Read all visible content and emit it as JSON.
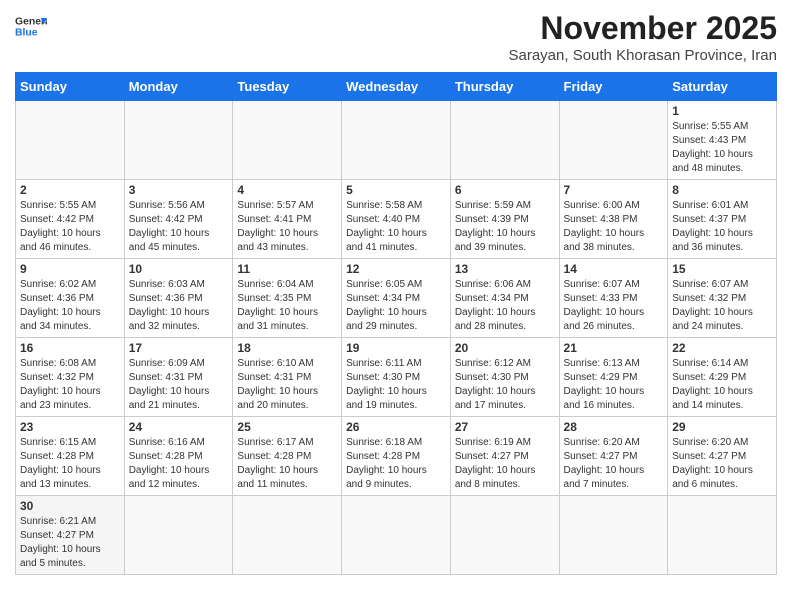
{
  "header": {
    "logo_general": "General",
    "logo_blue": "Blue",
    "month_year": "November 2025",
    "location": "Sarayan, South Khorasan Province, Iran"
  },
  "days_of_week": [
    "Sunday",
    "Monday",
    "Tuesday",
    "Wednesday",
    "Thursday",
    "Friday",
    "Saturday"
  ],
  "weeks": [
    [
      {
        "day": "",
        "info": ""
      },
      {
        "day": "",
        "info": ""
      },
      {
        "day": "",
        "info": ""
      },
      {
        "day": "",
        "info": ""
      },
      {
        "day": "",
        "info": ""
      },
      {
        "day": "",
        "info": ""
      },
      {
        "day": "1",
        "info": "Sunrise: 5:55 AM\nSunset: 4:43 PM\nDaylight: 10 hours\nand 48 minutes."
      }
    ],
    [
      {
        "day": "2",
        "info": "Sunrise: 5:55 AM\nSunset: 4:42 PM\nDaylight: 10 hours\nand 46 minutes."
      },
      {
        "day": "3",
        "info": "Sunrise: 5:56 AM\nSunset: 4:42 PM\nDaylight: 10 hours\nand 45 minutes."
      },
      {
        "day": "4",
        "info": "Sunrise: 5:57 AM\nSunset: 4:41 PM\nDaylight: 10 hours\nand 43 minutes."
      },
      {
        "day": "5",
        "info": "Sunrise: 5:58 AM\nSunset: 4:40 PM\nDaylight: 10 hours\nand 41 minutes."
      },
      {
        "day": "6",
        "info": "Sunrise: 5:59 AM\nSunset: 4:39 PM\nDaylight: 10 hours\nand 39 minutes."
      },
      {
        "day": "7",
        "info": "Sunrise: 6:00 AM\nSunset: 4:38 PM\nDaylight: 10 hours\nand 38 minutes."
      },
      {
        "day": "8",
        "info": "Sunrise: 6:01 AM\nSunset: 4:37 PM\nDaylight: 10 hours\nand 36 minutes."
      }
    ],
    [
      {
        "day": "9",
        "info": "Sunrise: 6:02 AM\nSunset: 4:36 PM\nDaylight: 10 hours\nand 34 minutes."
      },
      {
        "day": "10",
        "info": "Sunrise: 6:03 AM\nSunset: 4:36 PM\nDaylight: 10 hours\nand 32 minutes."
      },
      {
        "day": "11",
        "info": "Sunrise: 6:04 AM\nSunset: 4:35 PM\nDaylight: 10 hours\nand 31 minutes."
      },
      {
        "day": "12",
        "info": "Sunrise: 6:05 AM\nSunset: 4:34 PM\nDaylight: 10 hours\nand 29 minutes."
      },
      {
        "day": "13",
        "info": "Sunrise: 6:06 AM\nSunset: 4:34 PM\nDaylight: 10 hours\nand 28 minutes."
      },
      {
        "day": "14",
        "info": "Sunrise: 6:07 AM\nSunset: 4:33 PM\nDaylight: 10 hours\nand 26 minutes."
      },
      {
        "day": "15",
        "info": "Sunrise: 6:07 AM\nSunset: 4:32 PM\nDaylight: 10 hours\nand 24 minutes."
      }
    ],
    [
      {
        "day": "16",
        "info": "Sunrise: 6:08 AM\nSunset: 4:32 PM\nDaylight: 10 hours\nand 23 minutes."
      },
      {
        "day": "17",
        "info": "Sunrise: 6:09 AM\nSunset: 4:31 PM\nDaylight: 10 hours\nand 21 minutes."
      },
      {
        "day": "18",
        "info": "Sunrise: 6:10 AM\nSunset: 4:31 PM\nDaylight: 10 hours\nand 20 minutes."
      },
      {
        "day": "19",
        "info": "Sunrise: 6:11 AM\nSunset: 4:30 PM\nDaylight: 10 hours\nand 19 minutes."
      },
      {
        "day": "20",
        "info": "Sunrise: 6:12 AM\nSunset: 4:30 PM\nDaylight: 10 hours\nand 17 minutes."
      },
      {
        "day": "21",
        "info": "Sunrise: 6:13 AM\nSunset: 4:29 PM\nDaylight: 10 hours\nand 16 minutes."
      },
      {
        "day": "22",
        "info": "Sunrise: 6:14 AM\nSunset: 4:29 PM\nDaylight: 10 hours\nand 14 minutes."
      }
    ],
    [
      {
        "day": "23",
        "info": "Sunrise: 6:15 AM\nSunset: 4:28 PM\nDaylight: 10 hours\nand 13 minutes."
      },
      {
        "day": "24",
        "info": "Sunrise: 6:16 AM\nSunset: 4:28 PM\nDaylight: 10 hours\nand 12 minutes."
      },
      {
        "day": "25",
        "info": "Sunrise: 6:17 AM\nSunset: 4:28 PM\nDaylight: 10 hours\nand 11 minutes."
      },
      {
        "day": "26",
        "info": "Sunrise: 6:18 AM\nSunset: 4:28 PM\nDaylight: 10 hours\nand 9 minutes."
      },
      {
        "day": "27",
        "info": "Sunrise: 6:19 AM\nSunset: 4:27 PM\nDaylight: 10 hours\nand 8 minutes."
      },
      {
        "day": "28",
        "info": "Sunrise: 6:20 AM\nSunset: 4:27 PM\nDaylight: 10 hours\nand 7 minutes."
      },
      {
        "day": "29",
        "info": "Sunrise: 6:20 AM\nSunset: 4:27 PM\nDaylight: 10 hours\nand 6 minutes."
      }
    ],
    [
      {
        "day": "30",
        "info": "Sunrise: 6:21 AM\nSunset: 4:27 PM\nDaylight: 10 hours\nand 5 minutes."
      },
      {
        "day": "",
        "info": ""
      },
      {
        "day": "",
        "info": ""
      },
      {
        "day": "",
        "info": ""
      },
      {
        "day": "",
        "info": ""
      },
      {
        "day": "",
        "info": ""
      },
      {
        "day": "",
        "info": ""
      }
    ]
  ]
}
